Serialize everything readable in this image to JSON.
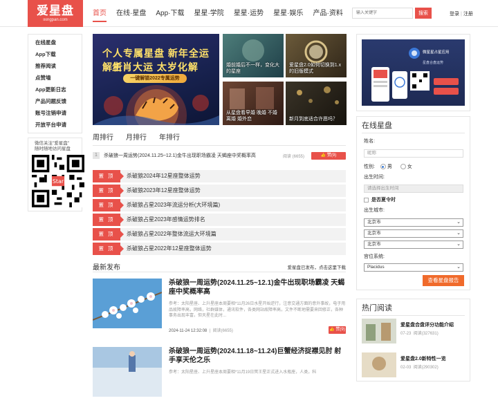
{
  "header": {
    "logo_cn": "爱星盘",
    "logo_en": "ixingpan.com",
    "nav": [
      "首页",
      "在线·星盘",
      "App·下载",
      "星星·学院",
      "星星·运势",
      "星星·娱乐",
      "产品·资料"
    ],
    "search_placeholder": "输入关键字",
    "search_btn": "搜索",
    "login": "登录",
    "register": "注册"
  },
  "left_menu": [
    "在线星盘",
    "App下载",
    "推荐阅读",
    "点赞墙",
    "App更新日志",
    "产品问题反馈",
    "账号注销申请",
    "开放平台申请"
  ],
  "qr": {
    "line1": "微信关注\"爱星盘\"",
    "line2": "随时随地访问星盘"
  },
  "banner": {
    "line1": "个人专属星盘 新年全运解析",
    "line2": "生肖大运 太岁化解",
    "line3": "一键解锁2022专属运势"
  },
  "thumbs": [
    {
      "caption": "婚前婚后不一样，变化大的星座"
    },
    {
      "caption": "爱星盘2.0如何切换到1.x的旧版模式"
    },
    {
      "caption": "从星盘看早婚 晚婚 不婚 离婚 婚外恋"
    },
    {
      "caption": "新月到底适合许愿吗？"
    }
  ],
  "rank_tabs": [
    "周排行",
    "月排行",
    "年排行"
  ],
  "rank_first": {
    "num": "1",
    "title": "杀破狼一周运势(2024.11.25~12.1)金牛出现职场霸凌 天蝎座中奖概率高",
    "reads": "阅读 (6655)",
    "like": "赞(9)"
  },
  "pinned": {
    "tag": "置 顶",
    "items": [
      "杀破狼2024年12星座整体运势",
      "杀破狼2023年12星座整体运势",
      "杀破狼占星2023年流运分析(大环境篇)",
      "杀破狼占星2023年感情运势排名",
      "杀破狼占星2022年整体流运大环境篇",
      "杀破狼占星2022年12星座整体运势"
    ]
  },
  "latest": {
    "title": "最新发布",
    "note": "爱星盘已发布，点击这里下载"
  },
  "posts": [
    {
      "title": "杀破狼一周运势(2024.11.25~12.1)金牛出现职场霸凌 天蝎座中奖概率高",
      "summary": "参考：太阳星座、上升星座本周要相*11月26日水星开始逆行，注意交通方面的意外事故，电子用品故障率高，网络，社群媒体，通讯软件，各类网站故障率高，文件不断地需要来回修正，各种事务出现丰富，但天星在此时...",
      "date": "2024-11-24 12:32:08",
      "reads": "阅读(6655)",
      "like": "赞(9)"
    },
    {
      "title": "杀破狼一周运势(2024.11.18~11.24)巨蟹经济捉襟见肘 射手享天伦之乐",
      "summary": "参考：太阳星座、上升星座本周要相*11月19日冥王星正式进入水瓶座，人类，科",
      "date": "",
      "reads": "",
      "like": ""
    }
  ],
  "online": {
    "title": "在线星盘",
    "name_label": "姓名:",
    "name_placeholder": "昵称",
    "gender_label": "性别:",
    "male": "男",
    "female": "女",
    "birth_label": "出生时间:",
    "birth_placeholder": "请选择出生时间",
    "dst_label": "是否夏令时",
    "city_label": "出生城市:",
    "cities": [
      "北京市",
      "北京市",
      "北京市"
    ],
    "house_label": "宫位系统:",
    "house_value": "Placidus",
    "submit": "查看星盘报告"
  },
  "hot": {
    "title": "热门阅读",
    "items": [
      {
        "title": "爱星盘合盘评分功能介绍",
        "date": "07-23",
        "reads": "阅读(327631)"
      },
      {
        "title": "爱星盘2.0新特性一览",
        "date": "02-03",
        "reads": "阅读(290302)"
      }
    ]
  },
  "ad": {
    "title": "微星星占星应用",
    "sub": "星盘合盘运势"
  },
  "colors": {
    "accent": "#e8514a",
    "submit": "#f06a2b"
  }
}
